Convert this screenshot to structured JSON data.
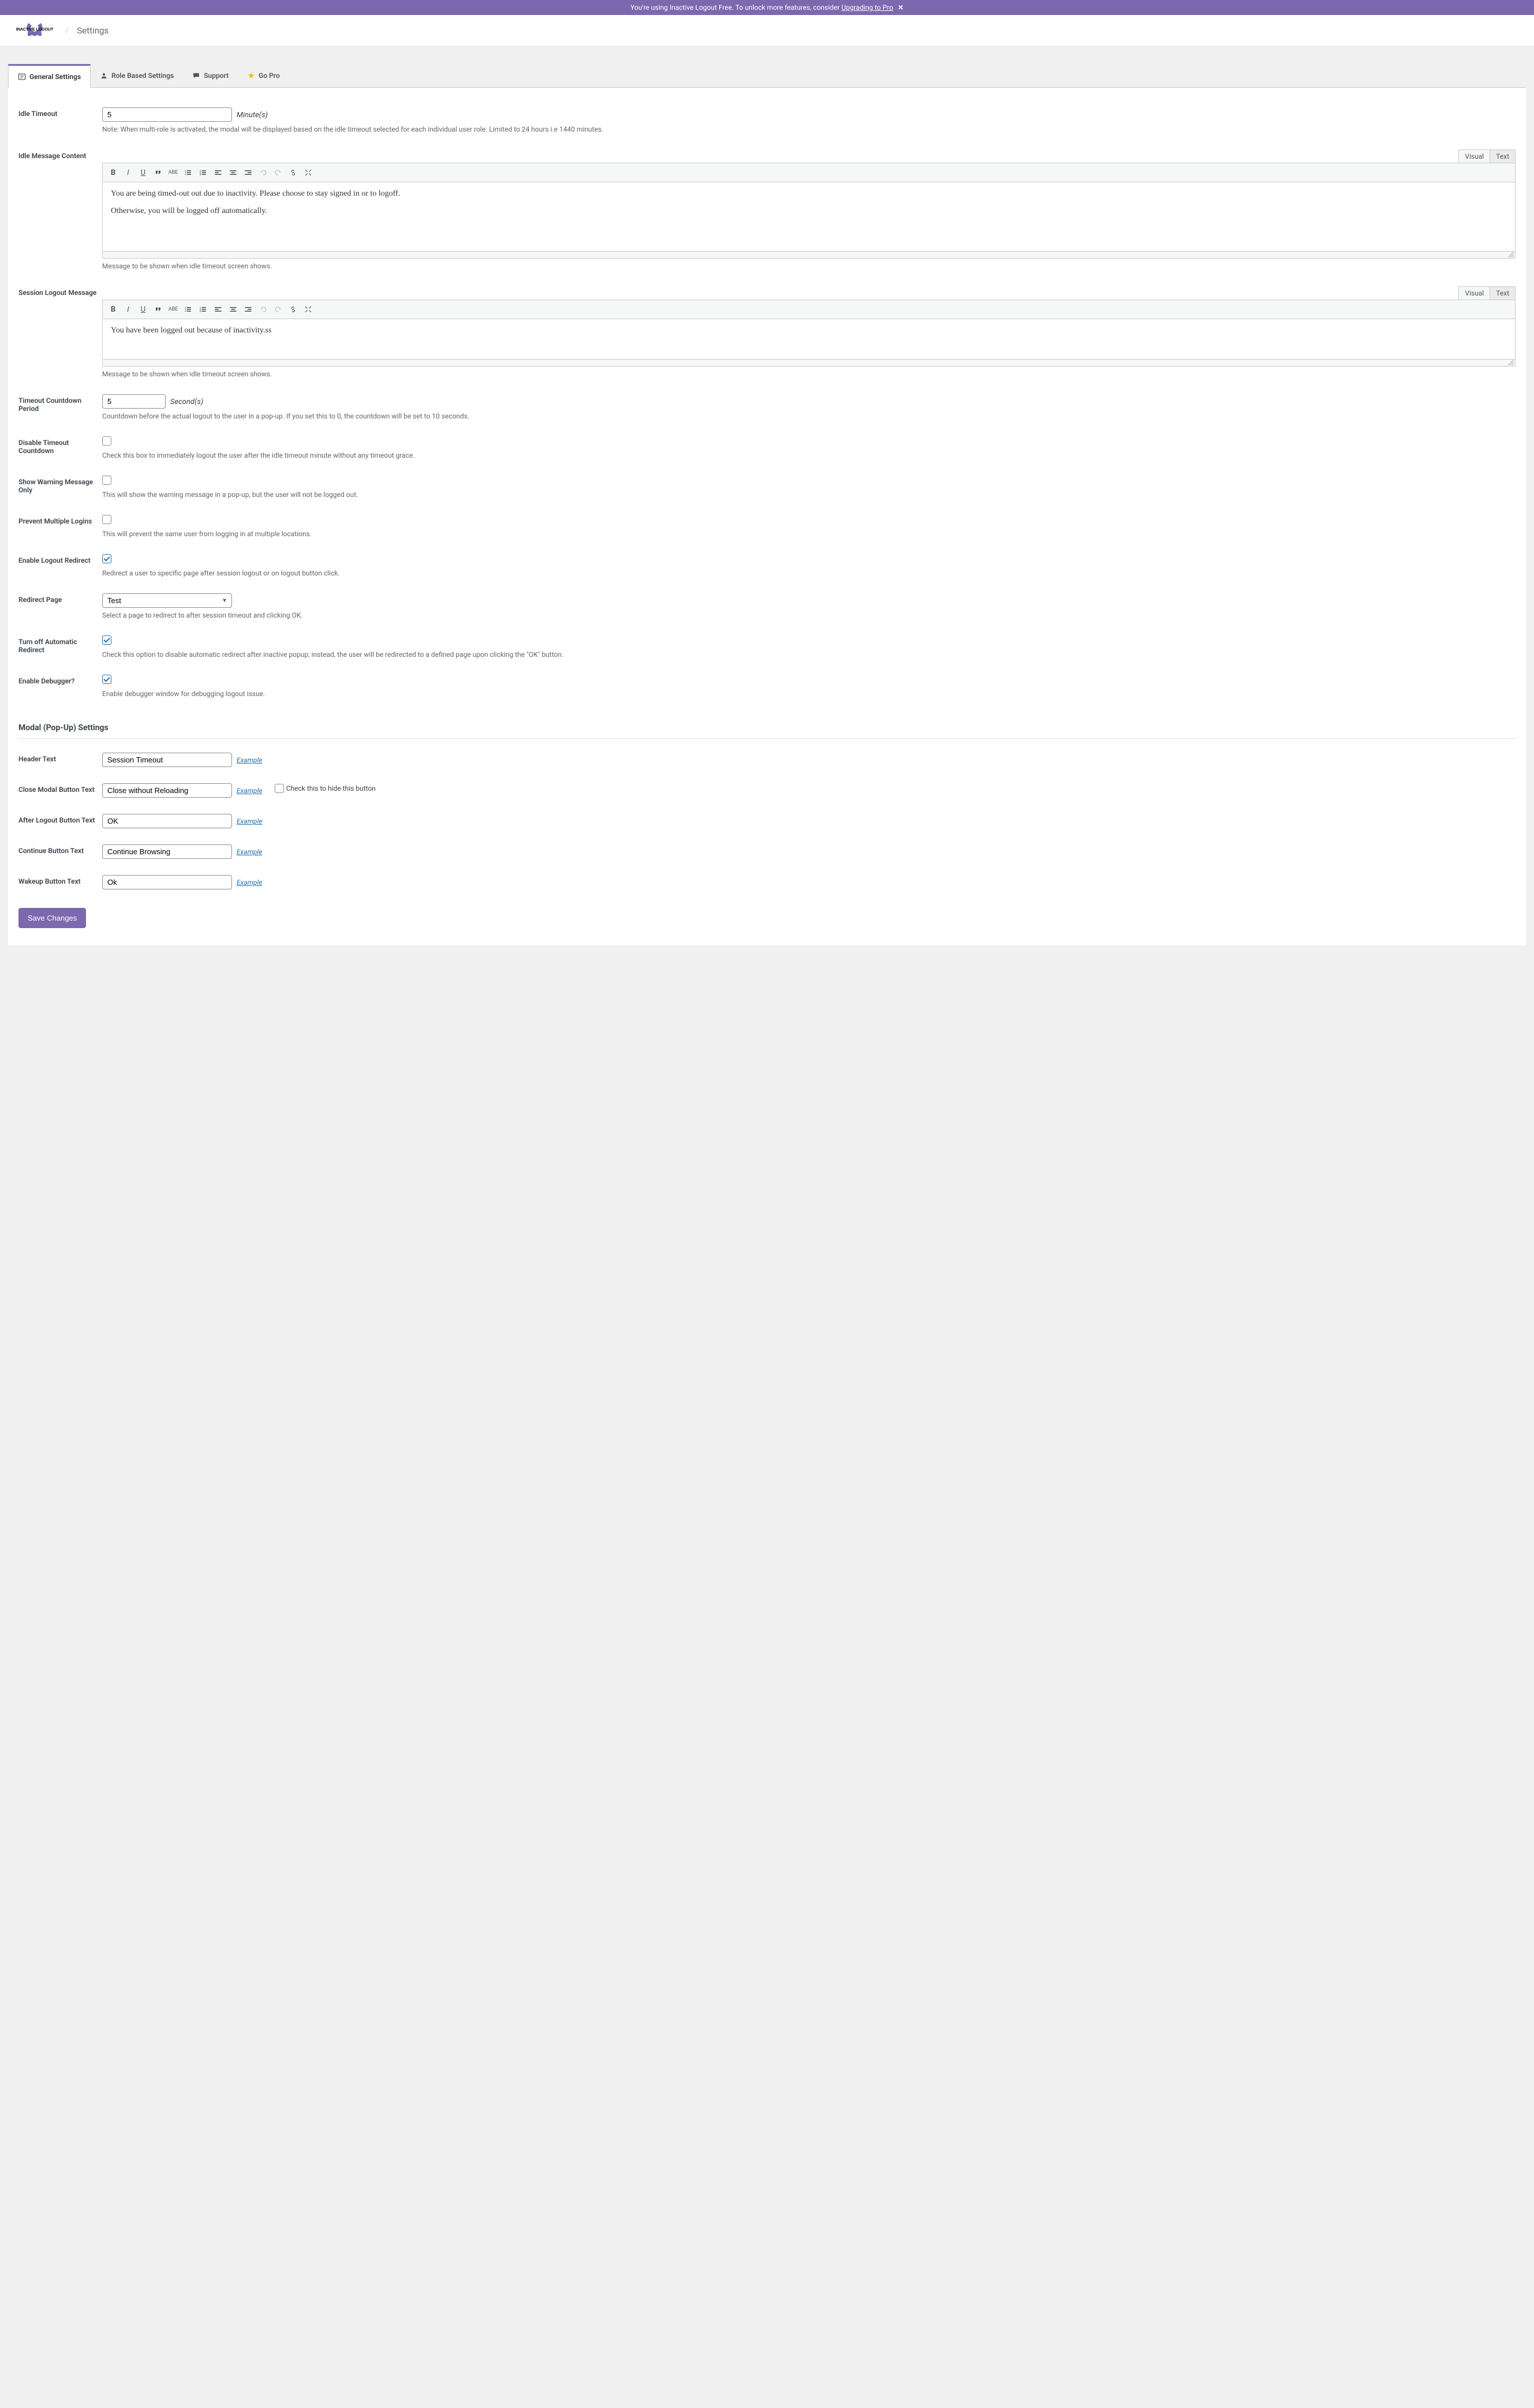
{
  "banner": {
    "text_prefix": "You're using Inactive Logout Free. To unlock more features, consider ",
    "link_text": "Upgrading to Pro"
  },
  "header": {
    "title": "Settings",
    "logo_text": "INACTIVE LOGOUT"
  },
  "tabs": [
    {
      "label": "General Settings"
    },
    {
      "label": "Role Based Settings"
    },
    {
      "label": "Support"
    },
    {
      "label": "Go Pro"
    }
  ],
  "fields": {
    "idle_timeout": {
      "label": "Idle Timeout",
      "value": "5",
      "unit": "Minute(s)",
      "desc": "Note: When multi-role is activated, the modal will be displayed based on the idle timeout selected for each individual user role. Limited to 24 hours i.e 1440 minutes."
    },
    "idle_message": {
      "label": "Idle Message Content",
      "p1": "You are being timed-out out due to inactivity. Please choose to stay signed in or to logoff.",
      "p2": "Otherwise, you will be logged off automatically.",
      "desc": "Message to be shown when idle timeout screen shows."
    },
    "session_logout": {
      "label": "Session Logout Message",
      "p1": "You have been logged out because of inactivity.ss",
      "desc": "Message to be shown when idle timeout screen shows."
    },
    "countdown": {
      "label": "Timeout Countdown Period",
      "value": "5",
      "unit": "Second(s)",
      "desc": "Countdown before the actual logout to the user in a pop-up. If you set this to 0, the countdown will be set to 10 seconds."
    },
    "disable_countdown": {
      "label": "Disable Timeout Countdown",
      "desc": "Check this box to immediately logout the user after the idle timeout minute without any timeout grace."
    },
    "warning_only": {
      "label": "Show Warning Message Only",
      "desc": "This will show the warning message in a pop-up, but the user will not be logged out."
    },
    "prevent_multi": {
      "label": "Prevent Multiple Logins",
      "desc": "This will prevent the same user from logging in at multiple locations."
    },
    "enable_redirect": {
      "label": "Enable Logout Redirect",
      "desc": "Redirect a user to specific page after session logout or on logout button click."
    },
    "redirect_page": {
      "label": "Redirect Page",
      "value": "Test",
      "desc": "Select a page to redirect to after session timeout and clicking OK."
    },
    "turn_off_auto": {
      "label": "Turn off Automatic Redirect",
      "desc": "Check this option to disable automatic redirect after inactive popup; instead, the user will be redirected to a defined page upon clicking the \"OK\" button."
    },
    "debugger": {
      "label": "Enable Debugger?",
      "desc": "Enable debugger window for debugging logout issue."
    }
  },
  "modal": {
    "title": "Modal (Pop-Up) Settings",
    "header_text": {
      "label": "Header Text",
      "value": "Session Timeout"
    },
    "close_btn": {
      "label": "Close Modal Button Text",
      "value": "Close without Reloading",
      "hide_label": "Check this to hide this button"
    },
    "after_logout": {
      "label": "After Logout Button Text",
      "value": "OK"
    },
    "continue_btn": {
      "label": "Continue Button Text",
      "value": "Continue Browsing"
    },
    "wakeup_btn": {
      "label": "Wakeup Button Text",
      "value": "Ok"
    }
  },
  "editor_tabs": {
    "visual": "Visual",
    "text": "Text"
  },
  "example": "Example",
  "save": "Save Changes"
}
